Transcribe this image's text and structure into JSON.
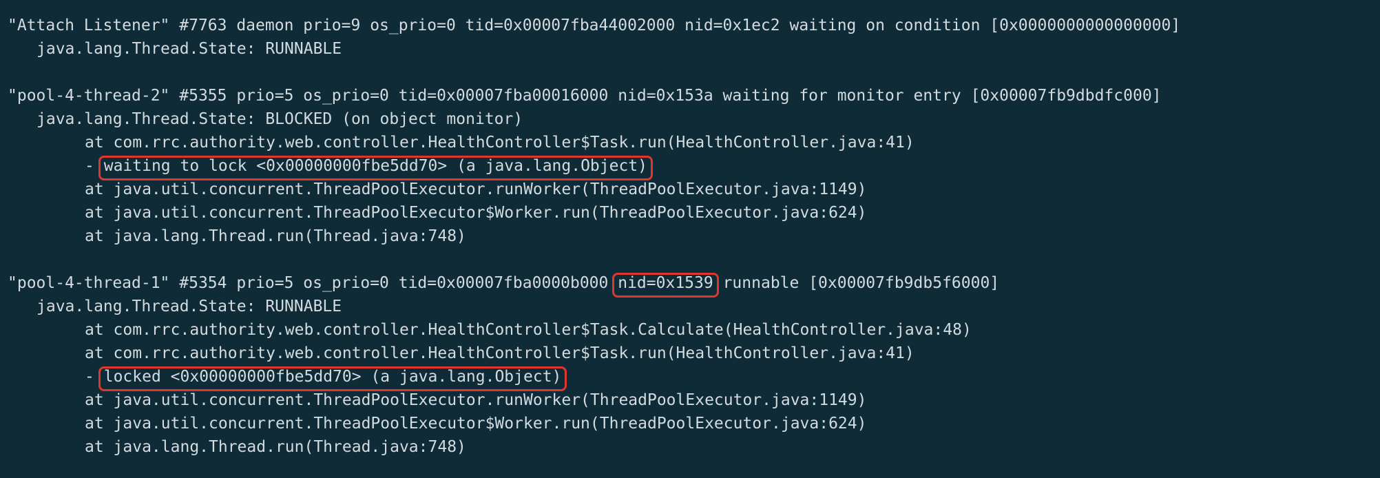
{
  "terminal": {
    "background": "#0f2b37",
    "text_color": "#d3dbdf",
    "highlight_color": "#e0362c",
    "attach_listener": {
      "header": "\"Attach Listener\" #7763 daemon prio=9 os_prio=0 tid=0x00007fba44002000 nid=0x1ec2 waiting on condition [0x0000000000000000]",
      "state": "java.lang.Thread.State: RUNNABLE"
    },
    "thread_2": {
      "header": "\"pool-4-thread-2\" #5355 prio=5 os_prio=0 tid=0x00007fba00016000 nid=0x153a waiting for monitor entry [0x00007fb9dbdfc000]",
      "state": "java.lang.Thread.State: BLOCKED (on object monitor)",
      "frame_1": "at com.rrc.authority.web.controller.HealthController$Task.run(HealthController.java:41)",
      "lock_dash": "-",
      "lock_text": "waiting to lock <0x00000000fbe5dd70> (a java.lang.Object)",
      "frame_2": "at java.util.concurrent.ThreadPoolExecutor.runWorker(ThreadPoolExecutor.java:1149)",
      "frame_3": "at java.util.concurrent.ThreadPoolExecutor$Worker.run(ThreadPoolExecutor.java:624)",
      "frame_4": "at java.lang.Thread.run(Thread.java:748)"
    },
    "thread_1": {
      "header_prefix": "\"pool-4-thread-1\" #5354 prio=5 os_prio=0 tid=0x00007fba0000b000",
      "header_nid": "nid=0x1539",
      "header_suffix": "runnable [0x00007fb9db5f6000]",
      "state": "java.lang.Thread.State: RUNNABLE",
      "frame_1": "at com.rrc.authority.web.controller.HealthController$Task.Calculate(HealthController.java:48)",
      "frame_2": "at com.rrc.authority.web.controller.HealthController$Task.run(HealthController.java:41)",
      "lock_dash": "-",
      "lock_text": "locked <0x00000000fbe5dd70> (a java.lang.Object)",
      "frame_3": "at java.util.concurrent.ThreadPoolExecutor.runWorker(ThreadPoolExecutor.java:1149)",
      "frame_4": "at java.util.concurrent.ThreadPoolExecutor$Worker.run(ThreadPoolExecutor.java:624)",
      "frame_5": "at java.lang.Thread.run(Thread.java:748)"
    }
  }
}
